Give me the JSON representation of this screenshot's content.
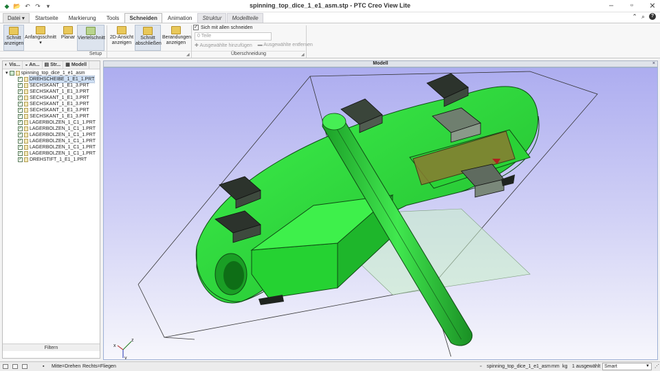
{
  "window": {
    "title": "spinning_top_dice_1_e1_asm.stp - PTC Creo View Lite",
    "qat_icons": [
      "app-logo-icon",
      "open-icon",
      "undo-icon",
      "redo-icon",
      "customize-icon"
    ],
    "controls": [
      "minimize-icon",
      "maximize-icon",
      "close-icon"
    ]
  },
  "menu_tabs": [
    {
      "label": "Datei",
      "arrow": "▾"
    },
    {
      "label": "Startseite"
    },
    {
      "label": "Markierung"
    },
    {
      "label": "Tools"
    },
    {
      "label": "Schneiden"
    },
    {
      "label": "Animation"
    },
    {
      "label": "Struktur"
    },
    {
      "label": "Modellteile"
    }
  ],
  "ribbon": {
    "buttons": {
      "schnitt_anzeigen": "Schnitt\nanzeigen",
      "anfangsschnitt": "Anfangsschnitt",
      "planar": "Planar",
      "viertelschnitt": "Viertelschnitt",
      "ansicht_2d": "2D-Ansicht\nanzeigen",
      "schnitt_abschliessen": "Schnitt\nabschließen",
      "berandungen": "Berandungen\nanzeigen"
    },
    "groups": {
      "setup": "Setup",
      "ueberschneidung": "Überschneidung"
    },
    "cut_all_label": "Sich mit allen schneiden",
    "cut_all_checked": true,
    "parts_placeholder": "0 Teile",
    "add_selected": "Ausgewählte hinzufügen",
    "remove_selected": "Ausgewählte entfernen"
  },
  "left_panel": {
    "tabs": [
      "Vis...",
      "An...",
      "Str...",
      "Modell"
    ],
    "root": "spinning_top_dice_1_e1_asm",
    "items": [
      {
        "label": "DREHSCHEIBE_1_E1_1.PRT",
        "selected": true
      },
      {
        "label": "SECHSKANT_1_E1_3.PRT"
      },
      {
        "label": "SECHSKANT_1_E1_3.PRT"
      },
      {
        "label": "SECHSKANT_1_E1_3.PRT"
      },
      {
        "label": "SECHSKANT_1_E1_3.PRT"
      },
      {
        "label": "SECHSKANT_1_E1_3.PRT"
      },
      {
        "label": "SECHSKANT_1_E1_3.PRT"
      },
      {
        "label": "LAGERBOLZEN_1_C1_1.PRT"
      },
      {
        "label": "LAGERBOLZEN_1_C1_1.PRT"
      },
      {
        "label": "LAGERBOLZEN_1_C1_1.PRT"
      },
      {
        "label": "LAGERBOLZEN_1_C1_1.PRT"
      },
      {
        "label": "LAGERBOLZEN_1_C1_1.PRT"
      },
      {
        "label": "LAGERBOLZEN_1_C1_1.PRT"
      },
      {
        "label": "DREHSTIFT_1_E1_1.PRT"
      }
    ],
    "filter_label": "Filtern"
  },
  "viewport": {
    "title": "Modell",
    "close": "×",
    "axis_labels": {
      "x": "x",
      "y": "y",
      "z": "z"
    },
    "colors": {
      "part_green": "#2ddc3a",
      "edge": "#123c12",
      "hex_nut": "#2a2f2a",
      "pin": "#22c233"
    }
  },
  "status": {
    "mouse_left": "Mitte=Drehen",
    "mouse_right": "Rechts=Fliegen",
    "file": "spinning_top_dice_1_e1_asm",
    "unit_length": "mm",
    "unit_mass": "kg",
    "selection": "1 ausgewählt",
    "mode": "Smart"
  }
}
